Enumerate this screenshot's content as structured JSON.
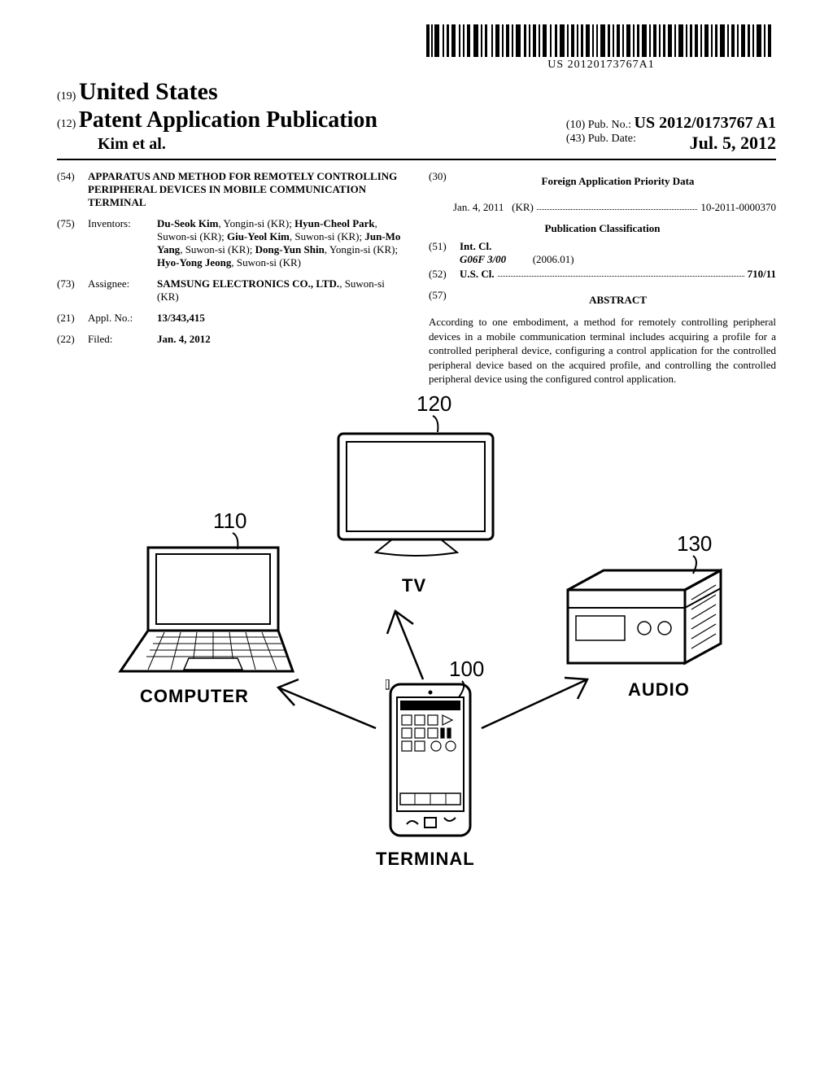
{
  "barcode_number": "US 20120173767A1",
  "masthead": {
    "country_code": "(19)",
    "country": "United States",
    "doc_type_code": "(12)",
    "doc_type": "Patent Application Publication",
    "author_line": "Kim et al.",
    "pubno_code": "(10)",
    "pubno_label": "Pub. No.:",
    "pubno": "US 2012/0173767 A1",
    "pubdate_code": "(43)",
    "pubdate_label": "Pub. Date:",
    "pubdate": "Jul. 5, 2012"
  },
  "biblio": {
    "title_code": "(54)",
    "title": "APPARATUS AND METHOD FOR REMOTELY CONTROLLING PERIPHERAL DEVICES IN MOBILE COMMUNICATION TERMINAL",
    "inventors_code": "(75)",
    "inventors_label": "Inventors:",
    "inventors": [
      {
        "name": "Du-Seok Kim",
        "loc": "Yongin-si (KR)"
      },
      {
        "name": "Hyun-Cheol Park",
        "loc": "Suwon-si (KR)"
      },
      {
        "name": "Giu-Yeol Kim",
        "loc": "Suwon-si (KR)"
      },
      {
        "name": "Jun-Mo Yang",
        "loc": "Suwon-si (KR)"
      },
      {
        "name": "Dong-Yun Shin",
        "loc": "Yongin-si (KR)"
      },
      {
        "name": "Hyo-Yong Jeong",
        "loc": "Suwon-si (KR)"
      }
    ],
    "assignee_code": "(73)",
    "assignee_label": "Assignee:",
    "assignee_name": "SAMSUNG ELECTRONICS CO., LTD.",
    "assignee_loc": "Suwon-si (KR)",
    "applno_code": "(21)",
    "applno_label": "Appl. No.:",
    "applno": "13/343,415",
    "filed_code": "(22)",
    "filed_label": "Filed:",
    "filed": "Jan. 4, 2012",
    "foreign_code": "(30)",
    "foreign_head": "Foreign Application Priority Data",
    "foreign_date": "Jan. 4, 2011",
    "foreign_country": "(KR)",
    "foreign_no": "10-2011-0000370",
    "pubclass_head": "Publication Classification",
    "intcl_code": "(51)",
    "intcl_label": "Int. Cl.",
    "intcl_symbol": "G06F 3/00",
    "intcl_edition": "(2006.01)",
    "uscl_code": "(52)",
    "uscl_label": "U.S. Cl.",
    "uscl_value": "710/11",
    "abstract_code": "(57)",
    "abstract_head": "ABSTRACT",
    "abstract": "According to one embodiment, a method for remotely controlling peripheral devices in a mobile communication terminal includes acquiring a profile for a controlled peripheral device, configuring a control application for the controlled peripheral device based on the acquired profile, and controlling the controlled peripheral device using the configured control application."
  },
  "figure": {
    "ref_110": "110",
    "ref_120": "120",
    "ref_130": "130",
    "ref_100": "100",
    "label_computer": "COMPUTER",
    "label_tv": "TV",
    "label_audio": "AUDIO",
    "label_terminal": "TERMINAL"
  }
}
